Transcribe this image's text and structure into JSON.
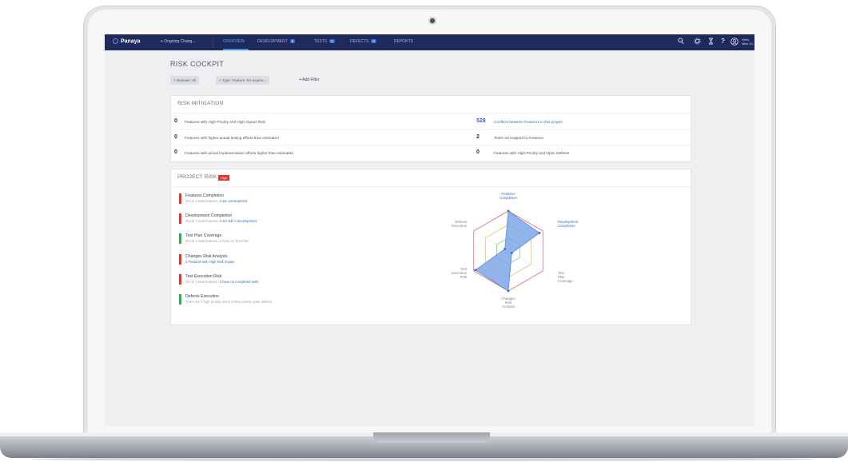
{
  "app": {
    "logo": "Panaya",
    "project": "Ongoing Chang...",
    "user_line1": "Hello",
    "user_line2": "Mike Gr."
  },
  "nav": {
    "tabs": [
      {
        "label": "OVERVIEW",
        "badge": ""
      },
      {
        "label": "DEVELOPMENT",
        "badge": "0"
      },
      {
        "label": "TESTS",
        "badge": "0"
      },
      {
        "label": "DEFECTS",
        "badge": "0"
      },
      {
        "label": "REPORTS",
        "badge": ""
      }
    ],
    "icons": [
      "search-icon",
      "gear-icon",
      "hourglass-icon",
      "help-icon",
      "user-icon"
    ],
    "help_glyph": "?"
  },
  "page": {
    "title": "RISK COCKPIT"
  },
  "filters": {
    "chips": [
      "× Release:  All",
      "× Type:  Feature; 54 require..."
    ],
    "add_label": "+ Add Filter"
  },
  "risk_mitigation": {
    "title": "RISK MITIGATION",
    "left": [
      {
        "value": "0",
        "text": "Features with High Priority and High Impact Risk"
      },
      {
        "value": "0",
        "text": "Features with higher actual testing efforts than estimated"
      },
      {
        "value": "0",
        "text": "Features with actual implementation efforts higher than estimated"
      }
    ],
    "right": [
      {
        "value": "528",
        "text": "Conflicts between Features in this project"
      },
      {
        "value": "2",
        "text": "Tests not mapped to Features"
      },
      {
        "value": "0",
        "text": "Features with High Priority and Open Defects"
      }
    ]
  },
  "project_risk": {
    "title": "PROJECT RISK",
    "level": "High",
    "items": [
      {
        "name": "Features Completion",
        "desc": "Out of 2 total features, ",
        "link": "2 are uncompleted",
        "status": "red"
      },
      {
        "name": "Development Completion",
        "desc": "Out of 2 total features, ",
        "link": "2 are still in development",
        "status": "red"
      },
      {
        "name": "Test Plan Coverage",
        "desc": "Out of 2 total features, 0 have no Test Plan",
        "link": "",
        "status": "green"
      },
      {
        "name": "Changes Risk Analysis",
        "desc": "",
        "link": "2 Features with High Risk Impact",
        "status": "red"
      },
      {
        "name": "Test Execution Risk",
        "desc": "Out of 2 total features, ",
        "link": "2 have no completed tests",
        "status": "red"
      },
      {
        "name": "Defects Execution",
        "desc": "There are 0 high priority and 0 critical priority open defects",
        "link": "",
        "status": "green"
      }
    ],
    "radar": {
      "axes": [
        "Features Completion",
        "Development Completion",
        "Test Plan Coverage",
        "Changes Risk Analysis",
        "Test Execution Risk",
        "Defects Execution"
      ],
      "values": [
        1,
        0.9,
        0.1,
        1,
        0.95,
        0.1
      ]
    }
  },
  "colors": {
    "nav_bg": "#1f2a5c",
    "accent": "#3866c7",
    "risk_red": "#e5322b",
    "risk_green": "#2fae4f",
    "radar_fill": "#7ea8e6"
  }
}
